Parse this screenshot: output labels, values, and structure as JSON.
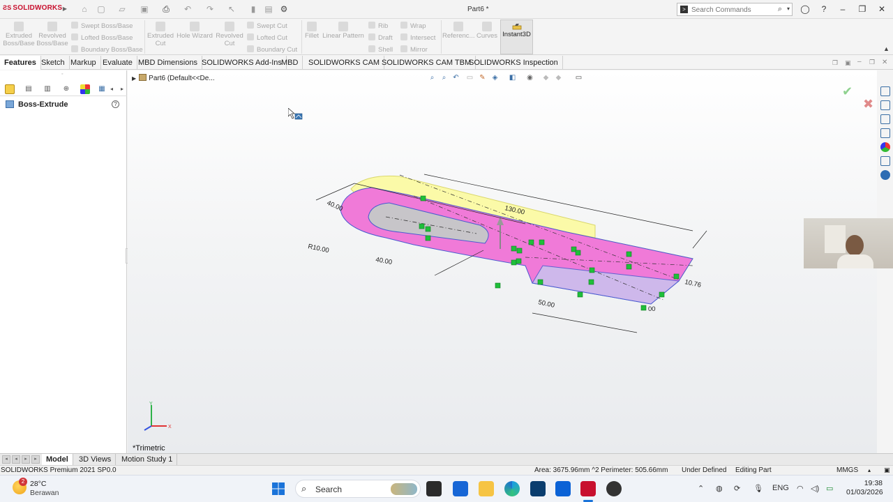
{
  "app": {
    "brand": "SOLIDWORKS",
    "doc_title": "Part6 *"
  },
  "search": {
    "placeholder": "Search Commands"
  },
  "ribbon": {
    "extruded_boss": "Extruded Boss/Base",
    "revolved_boss": "Revolved Boss/Base",
    "swept_boss": "Swept Boss/Base",
    "lofted_boss": "Lofted Boss/Base",
    "boundary_boss": "Boundary Boss/Base",
    "extruded_cut": "Extruded Cut",
    "hole_wizard": "Hole Wizard",
    "revolved_cut": "Revolved Cut",
    "swept_cut": "Swept Cut",
    "lofted_cut": "Lofted Cut",
    "boundary_cut": "Boundary Cut",
    "fillet": "Fillet",
    "linear_pattern": "Linear Pattern",
    "rib": "Rib",
    "draft": "Draft",
    "shell": "Shell",
    "wrap": "Wrap",
    "intersect": "Intersect",
    "mirror": "Mirror",
    "reference": "Referenc...",
    "curves": "Curves",
    "instant3d": "Instant3D"
  },
  "command_tabs": [
    "Features",
    "Sketch",
    "Markup",
    "Evaluate",
    "MBD Dimensions",
    "SOLIDWORKS Add-Ins",
    "MBD",
    "SOLIDWORKS CAM",
    "SOLIDWORKS CAM TBM",
    "SOLIDWORKS Inspection"
  ],
  "property_manager": {
    "title": "Boss-Extrude"
  },
  "tree": {
    "text": "Part6  (Default<<De..."
  },
  "viewport": {
    "view_label": "*Trimetric",
    "dims": {
      "d130": "130.00",
      "d40a": "40.00",
      "d40b": "40.00",
      "r10": "R10.00",
      "d50": "50.00",
      "d10_76": "10.76",
      "d00": "00"
    }
  },
  "bottom_tabs": [
    "Model",
    "3D Views",
    "Motion Study 1"
  ],
  "status": {
    "product": "SOLIDWORKS Premium 2021 SP0.0",
    "measure": "Area: 3675.96mm ^2 Perimeter: 505.66mm",
    "sketch_state": "Under Defined",
    "mode": "Editing Part",
    "units": "MMGS"
  },
  "taskbar": {
    "weather_temp": "28°C",
    "weather_cond": "Berawan",
    "weather_badge": "2",
    "search": "Search",
    "lang": "ENG",
    "time": "19:38",
    "date": "01/03/2026"
  },
  "colors": {
    "brand_red": "#c8102e",
    "body_pink": "#f07ad8",
    "yellow": "#fbfaa8",
    "sketch_green": "#1fbf3a",
    "accent_blue": "#3a6ea5"
  }
}
